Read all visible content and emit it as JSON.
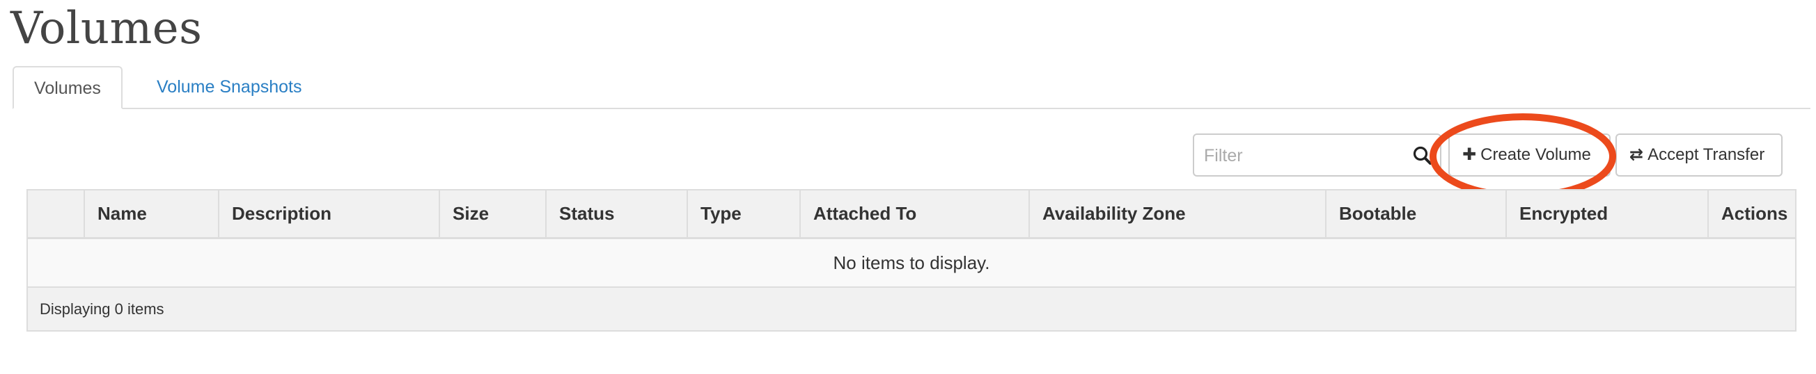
{
  "page": {
    "title": "Volumes"
  },
  "tabs": [
    {
      "label": "Volumes",
      "active": true
    },
    {
      "label": "Volume Snapshots",
      "active": false
    }
  ],
  "toolbar": {
    "filter_placeholder": "Filter",
    "filter_value": "",
    "create_label": "Create Volume",
    "create_icon": "plus-icon",
    "transfer_label": "Accept Transfer",
    "transfer_icon": "exchange-icon",
    "annotation_color": "#ec4a1c"
  },
  "table": {
    "columns": [
      "",
      "Name",
      "Description",
      "Size",
      "Status",
      "Type",
      "Attached To",
      "Availability Zone",
      "Bootable",
      "Encrypted",
      "Actions"
    ],
    "empty_message": "No items to display.",
    "footer": "Displaying 0 items"
  }
}
